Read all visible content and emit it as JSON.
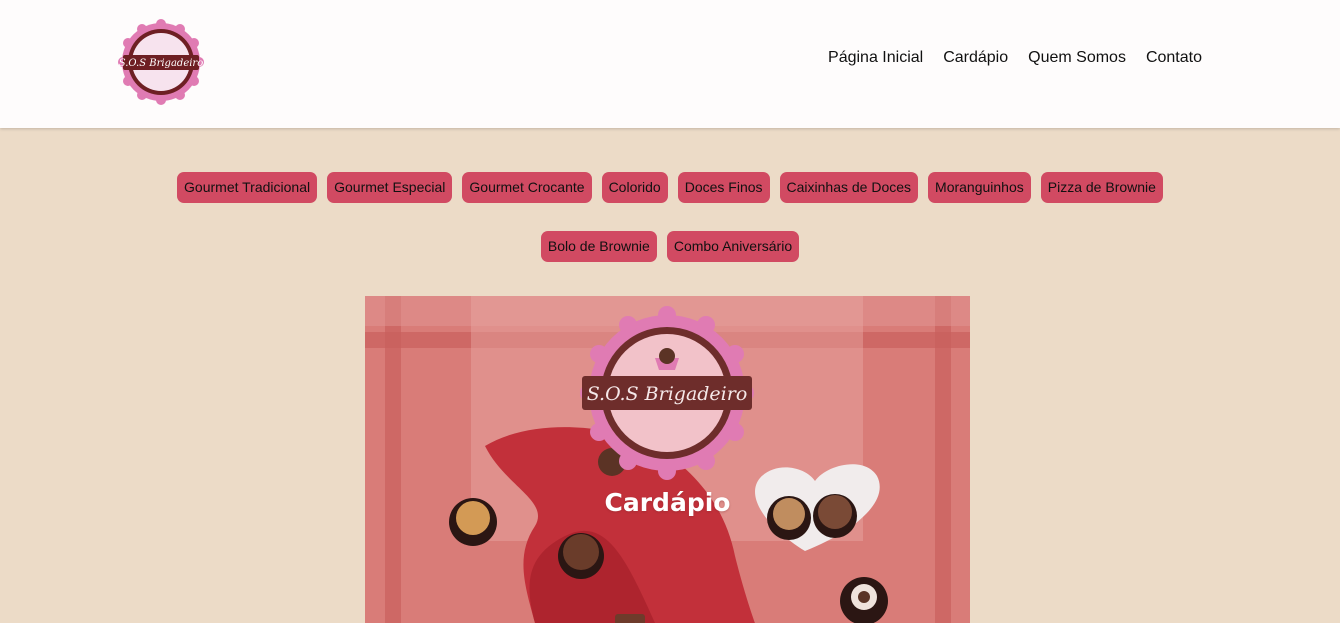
{
  "header": {
    "logo": {
      "text": "S.O.S Brigadeiro",
      "colors": {
        "ring": "#e07bb3",
        "band": "#6e1f23",
        "inner": "#f7e3ee"
      }
    },
    "nav": [
      "Página Inicial",
      "Cardápio",
      "Quem Somos",
      "Contato"
    ]
  },
  "categories": [
    "Gourmet Tradicional",
    "Gourmet Especial",
    "Gourmet Crocante",
    "Colorido",
    "Doces Finos",
    "Caixinhas de Doces",
    "Moranguinhos",
    "Pizza de Brownie",
    "Bolo de Brownie",
    "Combo Aniversário"
  ],
  "hero": {
    "title": "Cardápio",
    "logo_text": "S.O.S Brigadeiro",
    "colors": {
      "background": "#d97c78",
      "napkin": "#c2303a",
      "overlay": "#e9a8a4"
    }
  },
  "colors": {
    "page_bg": "#ecdbc7",
    "button_bg": "#d14a62",
    "header_bg": "#fefcfc"
  }
}
